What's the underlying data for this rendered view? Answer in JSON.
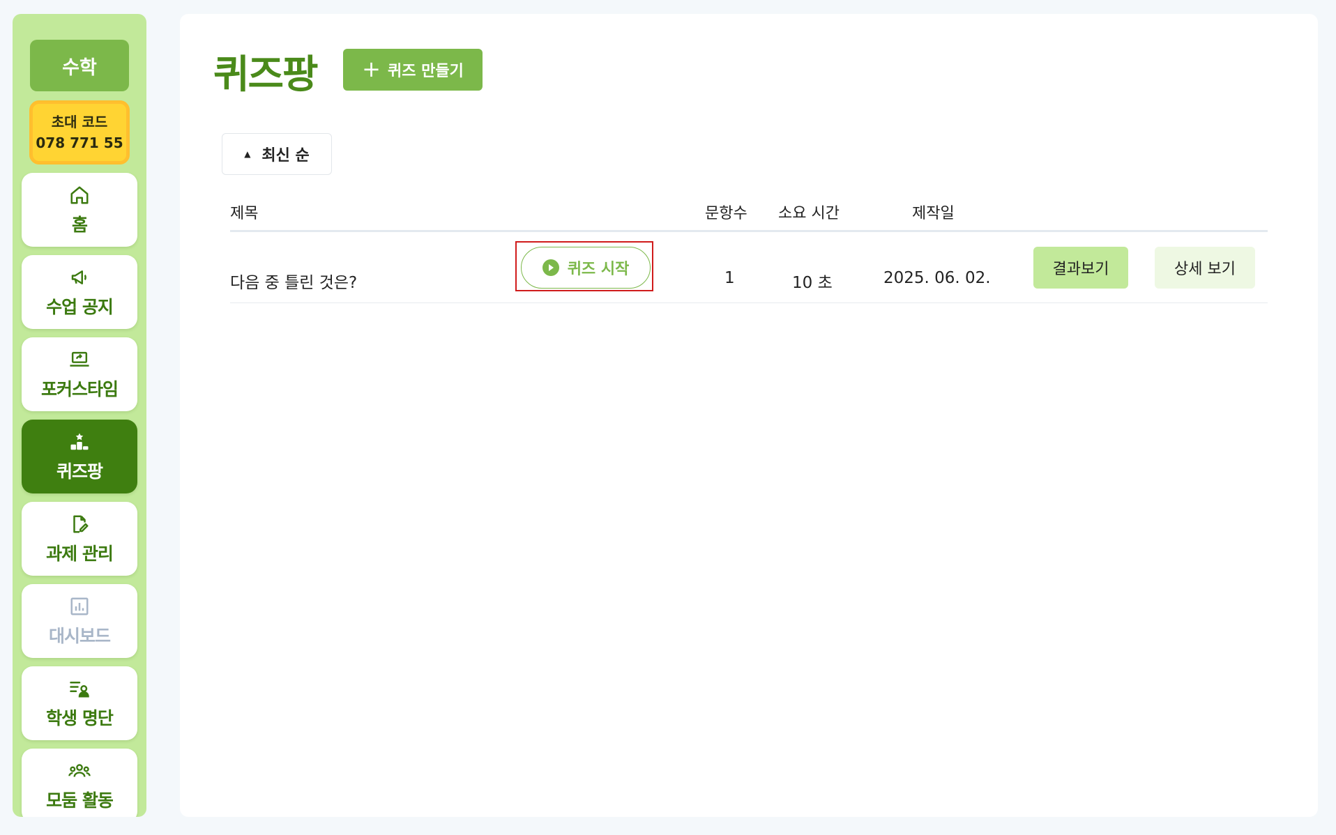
{
  "sidebar": {
    "class_name": "수학",
    "invite": {
      "label": "초대 코드",
      "code": "078 771 55"
    },
    "items": [
      {
        "label": "홈",
        "icon": "home-icon"
      },
      {
        "label": "수업 공지",
        "icon": "megaphone-icon"
      },
      {
        "label": "포커스타임",
        "icon": "laptop-icon"
      },
      {
        "label": "퀴즈팡",
        "icon": "podium-icon",
        "active": true
      },
      {
        "label": "과제 관리",
        "icon": "document-edit-icon"
      },
      {
        "label": "대시보드",
        "icon": "chart-icon",
        "disabled": true
      },
      {
        "label": "학생 명단",
        "icon": "student-list-icon"
      },
      {
        "label": "모둠 활동",
        "icon": "group-icon"
      }
    ]
  },
  "main": {
    "title": "퀴즈팡",
    "create_button": "퀴즈 만들기",
    "sort_label": "최신 순",
    "columns": {
      "title": "제목",
      "count": "문항수",
      "time": "소요 시간",
      "date": "제작일"
    },
    "rows": [
      {
        "title": "다음 중 틀린 것은?",
        "start_label": "퀴즈 시작",
        "count": "1",
        "time": "10 초",
        "date": "2025. 06. 02.",
        "result_label": "결과보기",
        "detail_label": "상세 보기"
      }
    ]
  },
  "colors": {
    "sidebar_bg": "#c2e99a",
    "accent": "#7cb84a",
    "active_nav": "#3f7f10",
    "title_green": "#4a8a1a",
    "invite_bg": "#ffd433",
    "highlight": "#d01b1b"
  }
}
